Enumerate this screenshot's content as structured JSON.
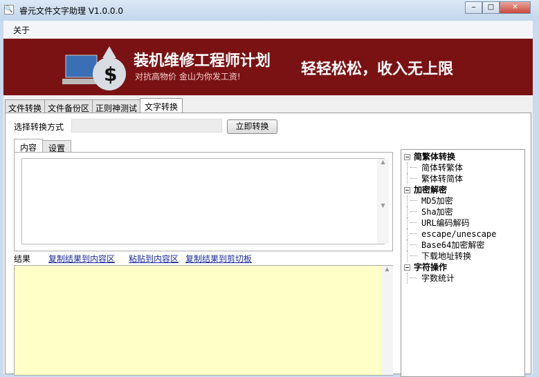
{
  "window": {
    "title": "睿元文件文字助理 V1.0.0.0",
    "minimize": "‒",
    "maximize": "□",
    "close": "✕"
  },
  "menu": {
    "about": "关于"
  },
  "banner": {
    "headline": "装机维修工程师计划",
    "subline": "对抗高物价 金山为你发工资!",
    "slogan": "轻轻松松，收入无上限"
  },
  "tabs": [
    "文件转换",
    "文件备份区",
    "正则神测试",
    "文字转换"
  ],
  "convert": {
    "method_label": "选择转换方式",
    "method_value": "",
    "convert_button": "立即转换"
  },
  "inner_tabs": [
    "内容",
    "设置"
  ],
  "content_text": "",
  "result": {
    "label": "结果",
    "links": [
      "复制结果到内容区",
      "粘贴到内容区",
      "复制结果到剪切板"
    ],
    "text": ""
  },
  "tree": [
    {
      "label": "简繁体转换",
      "children": [
        "简体转繁体",
        "繁体转简体"
      ]
    },
    {
      "label": "加密解密",
      "children": [
        "MD5加密",
        "Sha加密",
        "URL编码解码",
        "escape/unescape",
        "Base64加密解密",
        "下载地址转换"
      ]
    },
    {
      "label": "字符操作",
      "children": [
        "字数统计"
      ]
    }
  ]
}
